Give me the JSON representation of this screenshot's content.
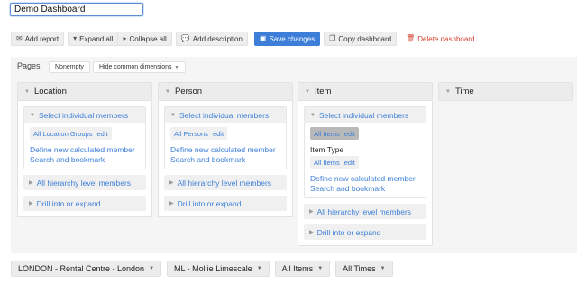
{
  "dashboard": {
    "title": "Demo Dashboard"
  },
  "toolbar": {
    "add_report": "Add report",
    "expand_all": "Expand all",
    "collapse_all": "Collapse all",
    "add_description": "Add description",
    "save_changes": "Save changes",
    "copy_dashboard": "Copy dashboard",
    "delete_dashboard": "Delete dashboard"
  },
  "pages": {
    "label": "Pages",
    "nonempty": "Nonempty",
    "hide_common": "Hide common dimensions"
  },
  "dimensions": {
    "location": {
      "title": "Location",
      "select_members": "Select individual members",
      "pill": "All Location Groups",
      "edit": "edit",
      "define_member": "Define new calculated member",
      "search": "Search and bookmark",
      "hierarchy": "All hierarchy level members",
      "drill": "Drill into or expand"
    },
    "person": {
      "title": "Person",
      "select_members": "Select individual members",
      "pill": "All Persons",
      "edit": "edit",
      "define_member": "Define new calculated member",
      "search": "Search and bookmark",
      "hierarchy": "All hierarchy level members",
      "drill": "Drill into or expand"
    },
    "item": {
      "title": "Item",
      "select_members": "Select individual members",
      "pill": "All Items",
      "edit": "edit",
      "item_type_label": "Item Type",
      "item_type_pill": "All Items",
      "item_type_edit": "edit",
      "define_member": "Define new calculated member",
      "search": "Search and bookmark",
      "hierarchy": "All hierarchy level members",
      "drill": "Drill into or expand"
    },
    "time": {
      "title": "Time"
    }
  },
  "bottom": {
    "location": "LONDON - Rental Centre - London",
    "person": "ML - Mollie Limescale",
    "items": "All Items",
    "times": "All Times"
  },
  "icons": {
    "add_report": "envelope-icon",
    "expand": "caret-down-icon",
    "collapse": "caret-right-icon",
    "description": "speech-bubble-icon",
    "save": "floppy-disk-icon",
    "copy": "copy-icon",
    "delete": "trash-icon"
  },
  "colors": {
    "primary": "#3d7fd8",
    "danger": "#d23c2a",
    "link": "#3d7fd8"
  }
}
